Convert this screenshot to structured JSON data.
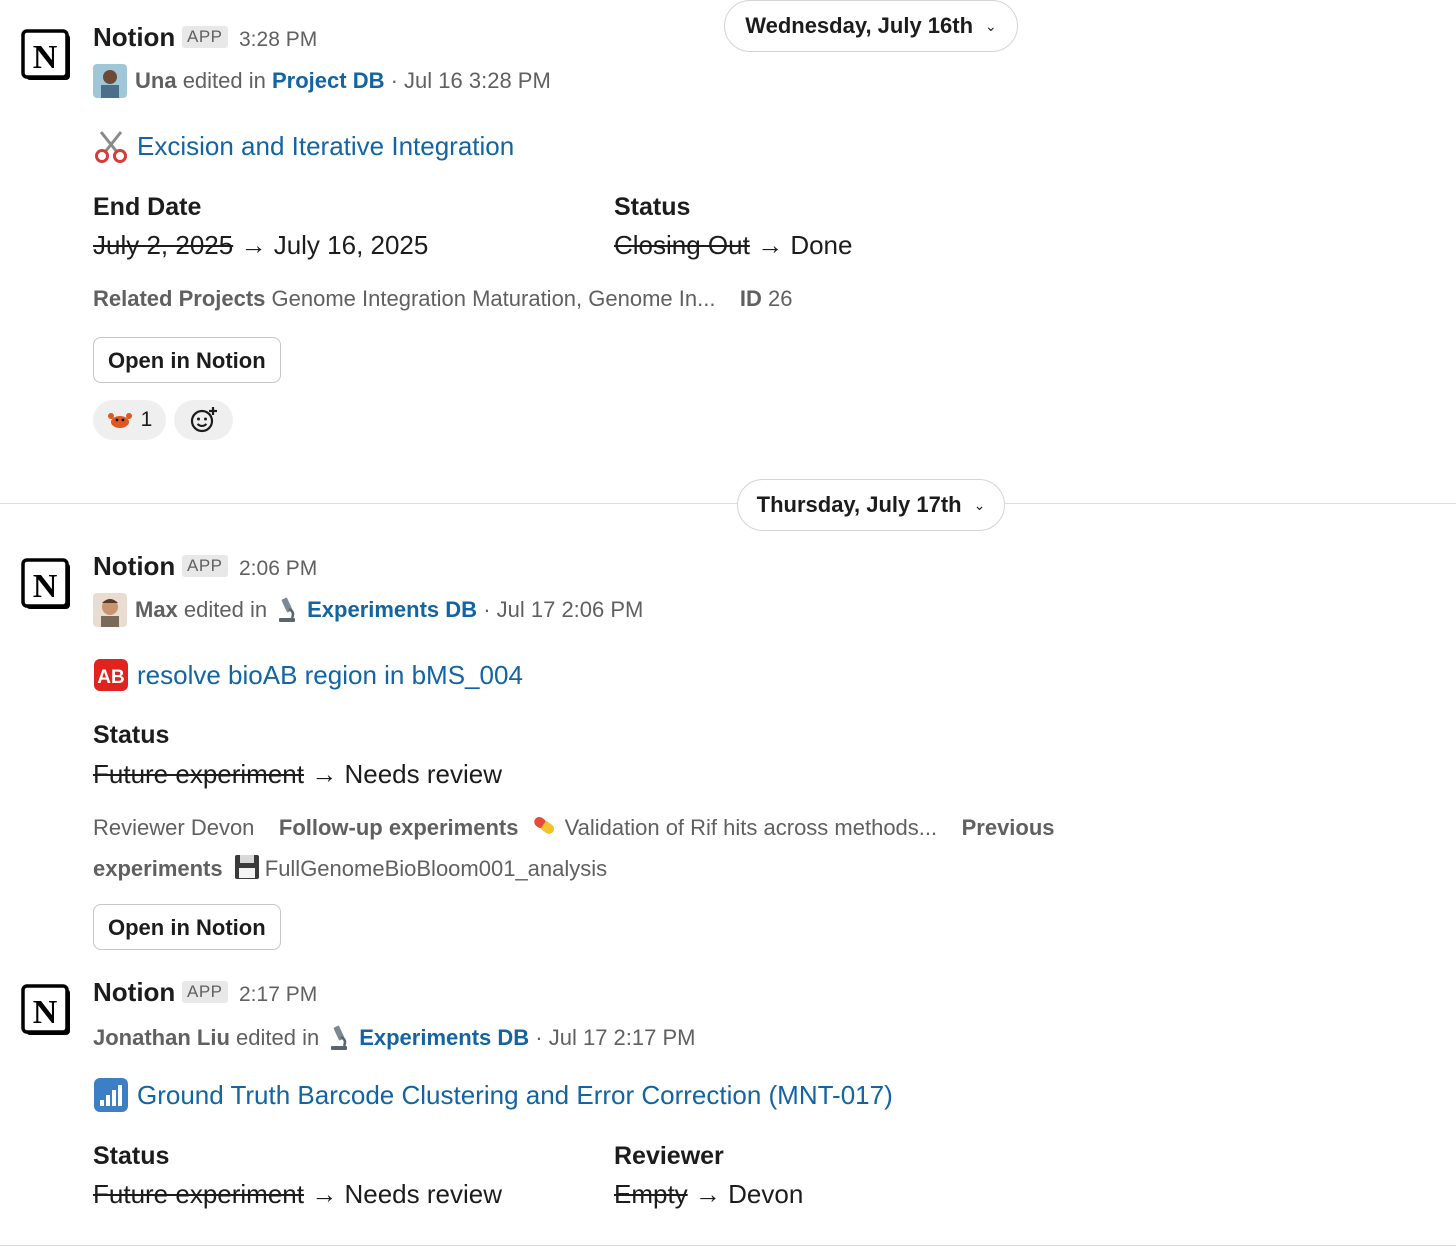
{
  "date_dividers": [
    {
      "label": "Wednesday, July 16th"
    },
    {
      "label": "Thursday, July 17th"
    }
  ],
  "messages": [
    {
      "sender": "Notion",
      "badge": "APP",
      "time": "3:28 PM",
      "editor": "Una",
      "edited_in": "edited in",
      "db": "Project DB",
      "timestamp": "· Jul 16 3:28 PM",
      "title": "Excision and Iterative Integration",
      "fields": [
        {
          "label": "End Date",
          "old": "July 2, 2025",
          "arrow": "→",
          "new": "July 16, 2025"
        },
        {
          "label": "Status",
          "old": "Closing Out",
          "arrow": "→",
          "new": "Done"
        }
      ],
      "meta": {
        "related_label": "Related Projects",
        "related_value": "Genome Integration Maturation, Genome In...",
        "id_label": "ID",
        "id_value": "26"
      },
      "button": "Open in Notion",
      "reaction_count": "1"
    },
    {
      "sender": "Notion",
      "badge": "APP",
      "time": "2:06 PM",
      "editor": "Max",
      "edited_in": "edited in",
      "db": "Experiments DB",
      "timestamp": "· Jul 17 2:06 PM",
      "title_emoji": "AB",
      "title": "resolve bioAB region in bMS_004",
      "fields": [
        {
          "label": "Status",
          "old": "Future experiment",
          "arrow": "→",
          "new": "Needs review"
        }
      ],
      "meta": {
        "reviewer_label": "Reviewer",
        "reviewer_value": "Devon",
        "followup_label": "Follow-up experiments",
        "followup_value": "Validation of Rif hits across methods...",
        "previous_label_1": "Previous",
        "previous_label_2": "experiments",
        "previous_value": "FullGenomeBioBloom001_analysis"
      },
      "button": "Open in Notion"
    },
    {
      "sender": "Notion",
      "badge": "APP",
      "time": "2:17 PM",
      "editor": "Jonathan Liu",
      "edited_in": "edited in",
      "db": "Experiments DB",
      "timestamp": "· Jul 17 2:17 PM",
      "title": "Ground Truth Barcode Clustering and Error Correction (MNT-017)",
      "fields": [
        {
          "label": "Status",
          "old": "Future experiment",
          "arrow": "→",
          "new": "Needs review"
        },
        {
          "label": "Reviewer",
          "old": "Empty",
          "arrow": "→",
          "new": "Devon"
        }
      ]
    }
  ]
}
